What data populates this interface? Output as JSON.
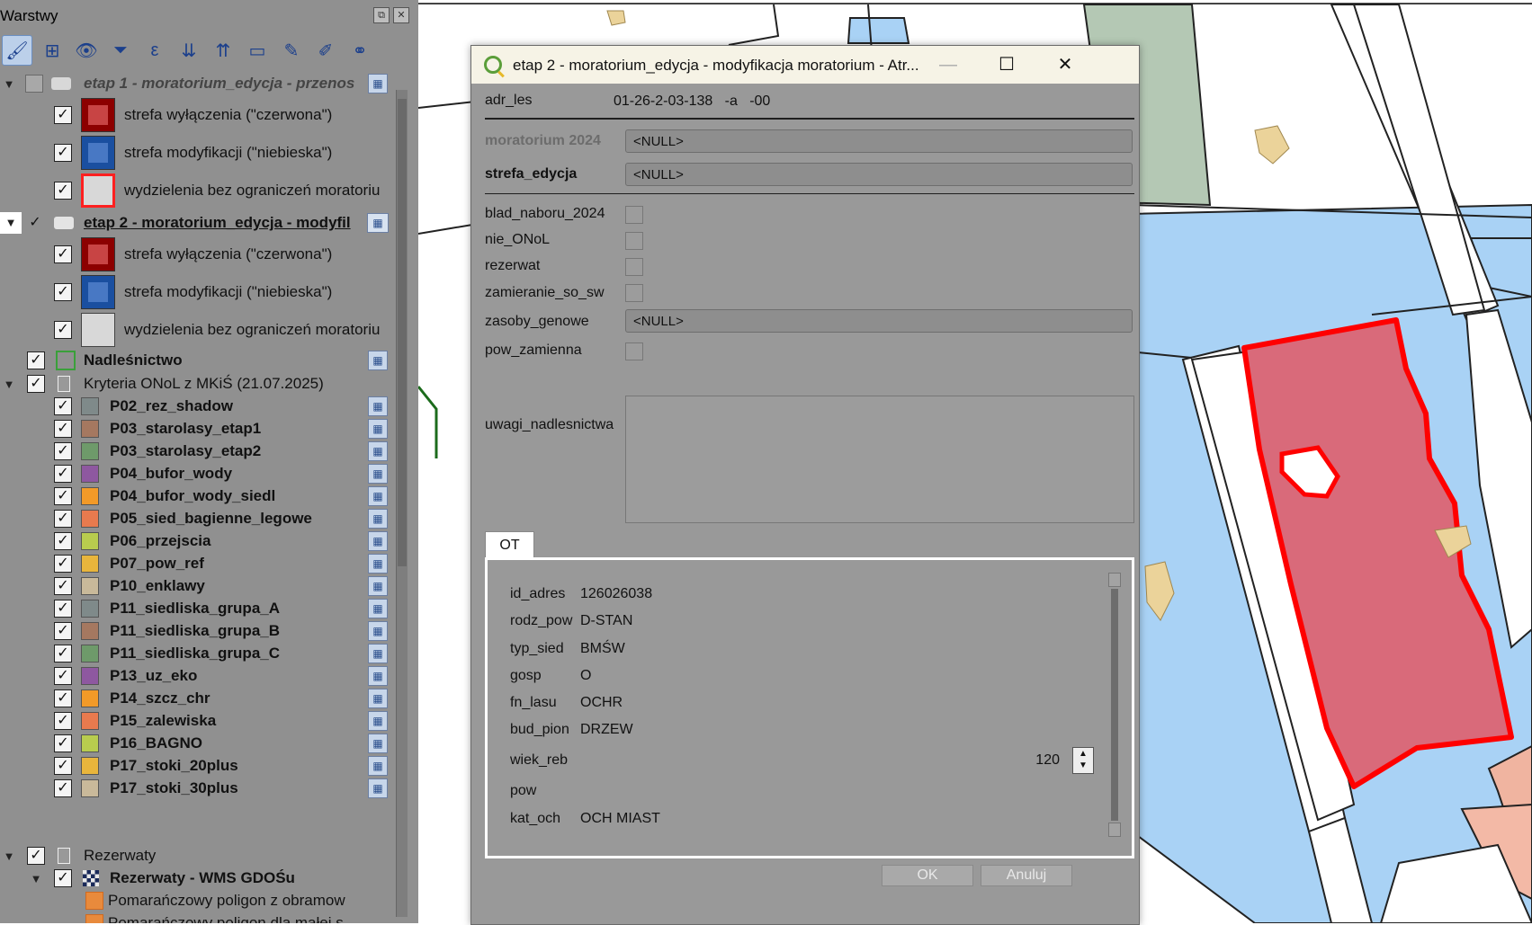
{
  "layers_panel": {
    "title": "Warstwy",
    "items": [
      {
        "name": "layer-group-etap1",
        "label": "etap 1 - moratorium_edycja - przenos",
        "bold": true,
        "italic": true,
        "checked": false
      },
      {
        "name": "layer-etap1-czerwona",
        "label": "strefa wyłączenia (\"czerwona\")"
      },
      {
        "name": "layer-etap1-niebieska",
        "label": "strefa modyfikacji (\"niebieska\")"
      },
      {
        "name": "layer-etap1-bez",
        "label": "wydzielenia bez ograniczeń moratoriu"
      },
      {
        "name": "layer-group-etap2",
        "label": "etap 2 - moratorium_edycja - modyfil",
        "bold": true,
        "underline": true
      },
      {
        "name": "layer-etap2-czerwona",
        "label": "strefa wyłączenia (\"czerwona\")"
      },
      {
        "name": "layer-etap2-niebieska",
        "label": "strefa modyfikacji (\"niebieska\")"
      },
      {
        "name": "layer-etap2-bez",
        "label": "wydzielenia bez ograniczeń moratoriu"
      },
      {
        "name": "layer-nadlesnictwo",
        "label": "Nadleśnictwo"
      },
      {
        "name": "layer-group-kryteria",
        "label": "Kryteria ONoL z MKiŚ (21.07.2025)"
      },
      {
        "name": "layer-p02",
        "label": "P02_rez_shadow",
        "color": "#7f8a8a"
      },
      {
        "name": "layer-p03a",
        "label": "P03_starolasy_etap1",
        "color": "#a57860"
      },
      {
        "name": "layer-p03b",
        "label": "P03_starolasy_etap2",
        "color": "#6e9a6a"
      },
      {
        "name": "layer-p04a",
        "label": "P04_bufor_wody",
        "color": "#8e58a0"
      },
      {
        "name": "layer-p04b",
        "label": "P04_bufor_wody_siedl",
        "color": "#f29a28"
      },
      {
        "name": "layer-p05",
        "label": "P05_sied_bagienne_legowe",
        "color": "#e87a4e"
      },
      {
        "name": "layer-p06",
        "label": "P06_przejscia",
        "color": "#b8cc4e"
      },
      {
        "name": "layer-p07",
        "label": "P07_pow_ref",
        "color": "#e8b53c"
      },
      {
        "name": "layer-p10",
        "label": "P10_enklawy",
        "color": "#c9b99a"
      },
      {
        "name": "layer-p11a",
        "label": "P11_siedliska_grupa_A",
        "color": "#7f8a8a"
      },
      {
        "name": "layer-p11b",
        "label": "P11_siedliska_grupa_B",
        "color": "#a57860"
      },
      {
        "name": "layer-p11c",
        "label": "P11_siedliska_grupa_C",
        "color": "#6e9a6a"
      },
      {
        "name": "layer-p13",
        "label": "P13_uz_eko",
        "color": "#8e58a0"
      },
      {
        "name": "layer-p14",
        "label": "P14_szcz_chr",
        "color": "#f29a28"
      },
      {
        "name": "layer-p15",
        "label": "P15_zalewiska",
        "color": "#e87a4e"
      },
      {
        "name": "layer-p16",
        "label": "P16_BAGNO",
        "color": "#b8cc4e"
      },
      {
        "name": "layer-p17a",
        "label": "P17_stoki_20plus",
        "color": "#e8b53c"
      },
      {
        "name": "layer-p17b",
        "label": "P17_stoki_30plus",
        "color": "#c9b99a"
      },
      {
        "name": "layer-group-rezerwaty",
        "label": "Rezerwaty"
      },
      {
        "name": "layer-rezerwaty-wms",
        "label": "Rezerwaty - WMS GDOŚu"
      },
      {
        "name": "legend-pomaranczowy-1",
        "label": "Pomarańczowy poligon z obramow"
      },
      {
        "name": "legend-pomaranczowy-2",
        "label": "Pomarańczowy poligon dla małej s"
      }
    ]
  },
  "dialog": {
    "title": "etap 2 - moratorium_edycja - modyfikacja moratorium - Atr...",
    "buttons": {
      "minimize": "—",
      "maximize": "☐",
      "close": "✕"
    },
    "fields": {
      "adr_les": {
        "label": "adr_les",
        "value": "01-26-2-03-138   -a   -00"
      },
      "moratorium_2024": {
        "label": "moratorium 2024",
        "value": "<NULL>"
      },
      "strefa_edycja": {
        "label": "strefa_edycja",
        "value": "<NULL>"
      },
      "blad_naboru_2024": {
        "label": "blad_naboru_2024"
      },
      "nie_ONoL": {
        "label": "nie_ONoL"
      },
      "rezerwat": {
        "label": "rezerwat"
      },
      "zamieranie_so_sw": {
        "label": "zamieranie_so_sw"
      },
      "zasoby_genowe": {
        "label": "zasoby_genowe",
        "value": "<NULL>"
      },
      "pow_zamienna": {
        "label": "pow_zamienna"
      },
      "uwagi_nadlesnictwa": {
        "label": "uwagi_nadlesnictwa",
        "value": ""
      }
    },
    "tab_label": "OT",
    "ot": [
      {
        "label": "id_adres",
        "value": "126026038"
      },
      {
        "label": "rodz_pow",
        "value": "D-STAN"
      },
      {
        "label": "typ_sied",
        "value": "BMŚW"
      },
      {
        "label": "gosp",
        "value": "O"
      },
      {
        "label": "fn_lasu",
        "value": "OCHR"
      },
      {
        "label": "bud_pion",
        "value": "DRZEW"
      },
      {
        "label": "wiek_reb",
        "value": ""
      },
      {
        "label": "pow",
        "value": ""
      },
      {
        "label": "kat_och",
        "value": "OCH MIAST"
      }
    ],
    "wiek_reb_spin": "120",
    "ok_label": "OK",
    "cancel_label": "Anuluj"
  },
  "colors": {
    "panel_bg": "#909090",
    "dialog_bg": "#999999",
    "selected_polygon_fill": "#d96a7a",
    "selected_polygon_stroke": "#ff0000",
    "water_blue": "#a9d2f5",
    "forest_green": "#b4c8b4",
    "sand": "#ebd39a"
  }
}
